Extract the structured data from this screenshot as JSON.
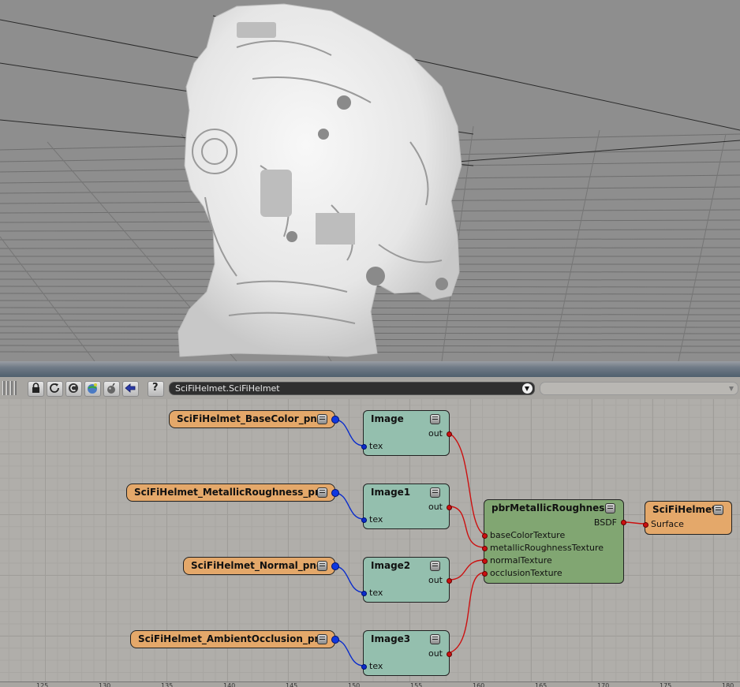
{
  "toolbar": {
    "lock_tip": "lock",
    "path": "SciFiHelmet.SciFiHelmet",
    "filter": "",
    "help_label": "?"
  },
  "nodes": {
    "tex1": {
      "label": "SciFiHelmet_BaseColor_png"
    },
    "tex2": {
      "label": "SciFiHelmet_MetallicRoughness_png"
    },
    "tex3": {
      "label": "SciFiHelmet_Normal_png"
    },
    "tex4": {
      "label": "SciFiHelmet_AmbientOcclusion_png"
    },
    "img0": {
      "title": "Image",
      "in": "tex",
      "out": "out"
    },
    "img1": {
      "title": "Image1",
      "in": "tex",
      "out": "out"
    },
    "img2": {
      "title": "Image2",
      "in": "tex",
      "out": "out"
    },
    "img3": {
      "title": "Image3",
      "in": "tex",
      "out": "out"
    },
    "material": {
      "title": "pbrMetallicRoughness",
      "out": "BSDF",
      "inputs": [
        "baseColorTexture",
        "metallicRoughnessTexture",
        "normalTexture",
        "occlusionTexture"
      ]
    },
    "output": {
      "title": "SciFiHelmet",
      "in": "Surface"
    }
  },
  "ruler": {
    "ticks": [
      "125",
      "130",
      "135",
      "140",
      "145",
      "150",
      "155",
      "160",
      "165",
      "170",
      "175",
      "180"
    ]
  },
  "colors": {
    "texture_node": "#e4a86a",
    "image_node": "#94bfae",
    "material_node": "#81a672",
    "wire_blue": "#0a2ccc",
    "wire_red": "#cc1010"
  },
  "icons": [
    "lock-icon",
    "refresh-icon",
    "copy-icon",
    "globe-icon",
    "bomb-icon",
    "back-arrow-icon",
    "help-icon"
  ]
}
